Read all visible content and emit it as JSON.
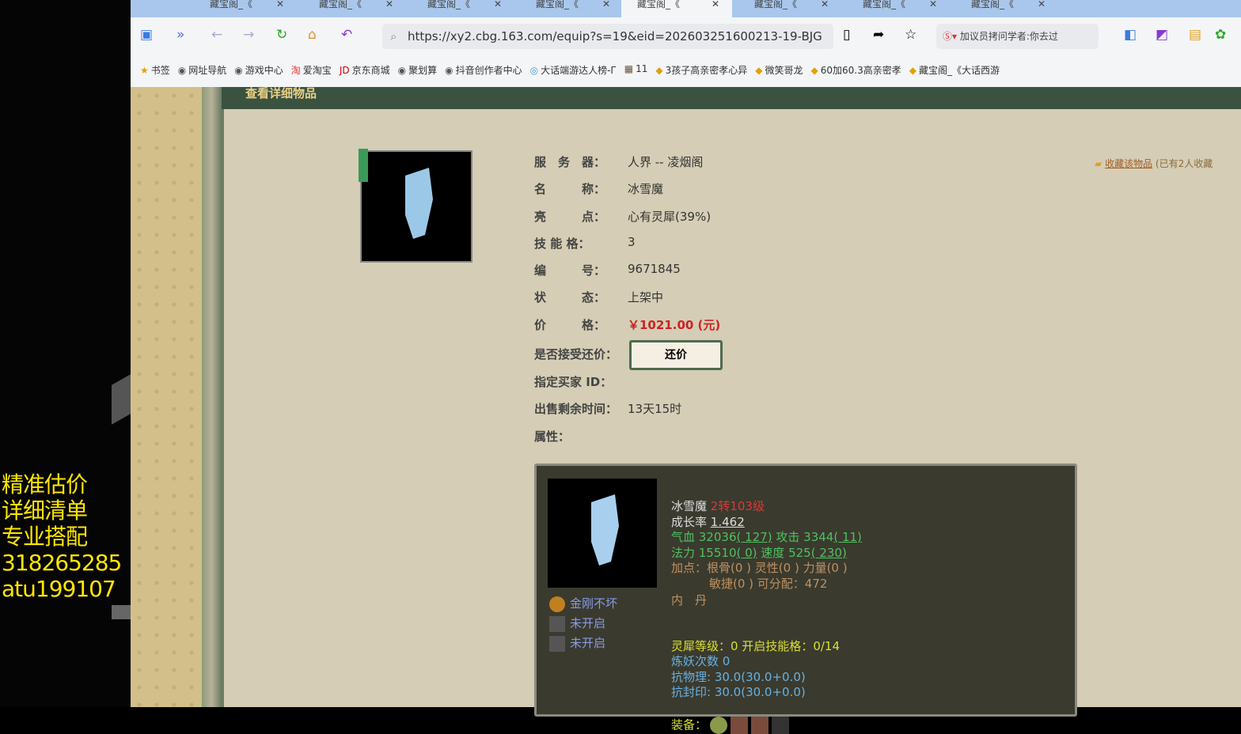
{
  "promo": {
    "lines": [
      "精准估价",
      "详细清单",
      "专业搭配",
      "318265285",
      "atu199107"
    ]
  },
  "browser": {
    "tabs": [
      "藏宝阁_《",
      "藏宝阁_《",
      "藏宝阁_《",
      "藏宝阁_《",
      "藏宝阁_《",
      "藏宝阁_《",
      "藏宝阁_《",
      "藏宝阁_《"
    ],
    "active_tab": 4,
    "url": "https://xy2.cbg.163.com/equip?s=19&eid=202603251600213-19-BJG",
    "search": "加议员拷问学者:你去过",
    "bookmarks": [
      "书签",
      "网址导航",
      "游戏中心",
      "爱淘宝",
      "京东商城",
      "聚划算",
      "抖音创作者中心",
      "大话端游达人榜-Г",
      "11",
      "3孩子高亲密孝心异",
      "微笑哥龙",
      "60加60.3高亲密孝",
      "藏宝阁_《大话西游"
    ]
  },
  "page": {
    "header": "查看详细物品",
    "favorite": {
      "link": "收藏该物品",
      "count": "(已有2人收藏"
    },
    "fields": [
      {
        "k": "服　务　器：",
        "v": "人界 -- 凌烟阁"
      },
      {
        "k": "名　　　称：",
        "v": "冰雪魔"
      },
      {
        "k": "亮　　　点：",
        "v": "心有灵犀(39%)"
      },
      {
        "k": "技 能 格：",
        "v": "3"
      },
      {
        "k": "编　　　号：",
        "v": "9671845"
      },
      {
        "k": "状　　　态：",
        "v": "上架中"
      },
      {
        "k": "价　　　格：",
        "v": "￥1021.00 (元)"
      }
    ],
    "bargain_label": "是否接受还价：",
    "bargain_button": "还价",
    "buyer_label": "指定买家 ID：",
    "remain_label": "出售剩余时间：",
    "remain_value": "13天15时",
    "attr_label": "属性："
  },
  "pet": {
    "name": "冰雪魔",
    "level": "2转103级",
    "growth_label": "成长率",
    "growth": "1.462",
    "hp": "气血 32036",
    "hp_b": "( 127)",
    "atk": "攻击 3344",
    "atk_b": "( 11)",
    "mp": "法力 15510",
    "mp_b": "( 0)",
    "spd": "速度 525",
    "spd_b": "( 230)",
    "points1": "加点：根骨(0 ) 灵性(0 ) 力量(0 )",
    "points2": "敏捷(0 ) 可分配：472",
    "neidan": "内　丹",
    "skills": [
      "金刚不坏",
      "未开启",
      "未开启"
    ],
    "lingxi": "灵犀等级：0 开启技能格：0/14",
    "lianyao": "炼妖次数 0",
    "kwl": "抗物理: 30.0(30.0+0.0)",
    "kfy": "抗封印: 30.0(30.0+0.0)",
    "equip": "装备："
  }
}
